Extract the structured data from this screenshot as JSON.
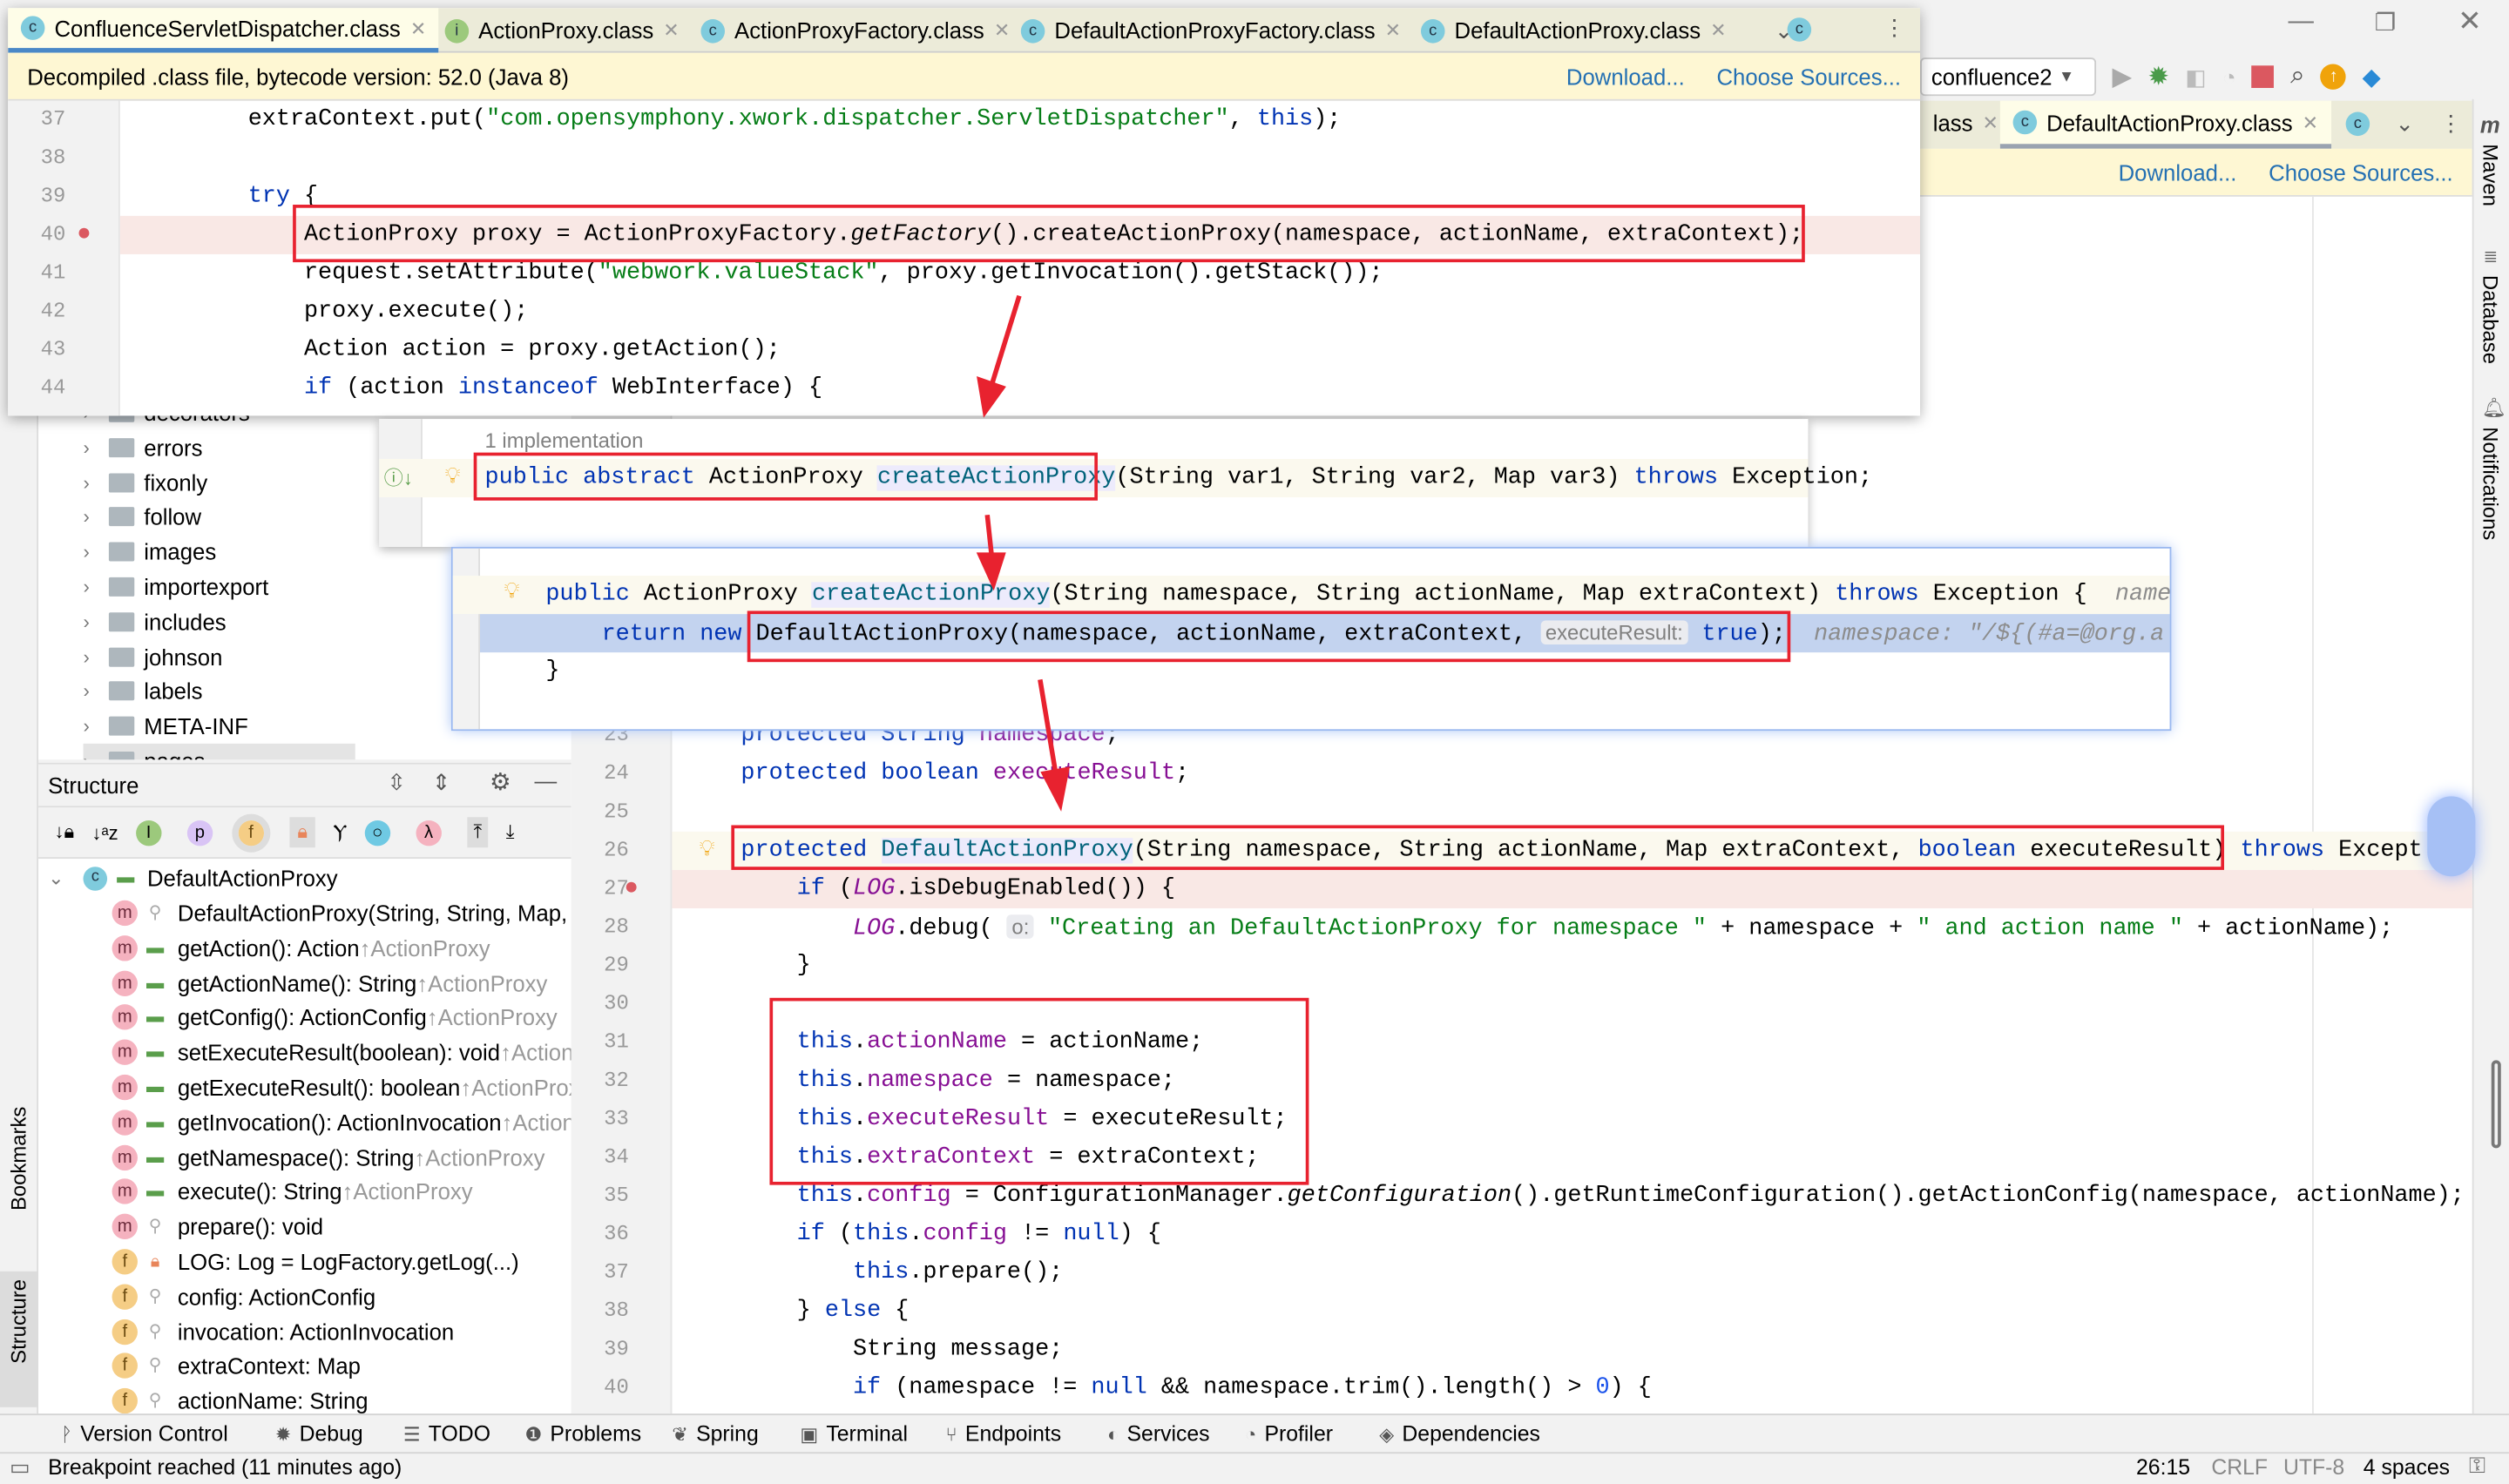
{
  "window": {
    "controls": [
      "minimize",
      "restore",
      "close"
    ]
  },
  "popup_editor": {
    "tabs": [
      {
        "label": "ConfluenceServletDispatcher.class",
        "icon": "C",
        "active": true
      },
      {
        "label": "ActionProxy.class",
        "icon": "I"
      },
      {
        "label": "ActionProxyFactory.class",
        "icon": "C"
      },
      {
        "label": "DefaultActionProxyFactory.class",
        "icon": "C"
      },
      {
        "label": "DefaultActionProxy.class",
        "icon": "C"
      }
    ],
    "banner": "Decompiled .class file, bytecode version: 52.0 (Java 8)",
    "download": "Download...",
    "choose_sources": "Choose Sources...",
    "lines": [
      {
        "n": "37",
        "ind": 2,
        "t": [
          [
            "extraContext.put(",
            "n"
          ],
          [
            "\"com.opensymphony.xwork.dispatcher.ServletDispatcher\"",
            "s"
          ],
          [
            ", ",
            "n"
          ],
          [
            "this",
            "k"
          ],
          [
            ");",
            "n"
          ]
        ]
      },
      {
        "n": "38",
        "ind": 0,
        "t": []
      },
      {
        "n": "39",
        "ind": 2,
        "t": [
          [
            "try",
            "k"
          ],
          [
            " {",
            "n"
          ]
        ]
      },
      {
        "n": "40",
        "ind": 3,
        "bp": true,
        "t": [
          [
            "ActionProxy proxy = ActionProxyFactory.",
            "n"
          ],
          [
            "getFactory",
            "i"
          ],
          [
            "().createActionProxy(namespace, actionName, extraContext);",
            "n"
          ]
        ]
      },
      {
        "n": "41",
        "ind": 3,
        "t": [
          [
            "request.setAttribute(",
            "n"
          ],
          [
            "\"webwork.valueStack\"",
            "s"
          ],
          [
            ", proxy.getInvocation().getStack());",
            "n"
          ]
        ]
      },
      {
        "n": "42",
        "ind": 3,
        "t": [
          [
            "proxy.execute();",
            "n"
          ]
        ]
      },
      {
        "n": "43",
        "ind": 3,
        "t": [
          [
            "Action action = proxy.getAction();",
            "n"
          ]
        ]
      },
      {
        "n": "44",
        "ind": 3,
        "t": [
          [
            "if",
            "k"
          ],
          [
            " (action ",
            "n"
          ],
          [
            "instanceof",
            "k"
          ],
          [
            " WebInterface) {",
            "n"
          ]
        ]
      }
    ]
  },
  "toolbar": {
    "run_config": "confluence2"
  },
  "main_tabs": [
    {
      "label": "lass"
    },
    {
      "label": "DefaultActionProxy.class",
      "active": true
    }
  ],
  "main_banner": {
    "download": "Download...",
    "choose_sources": "Choose Sources..."
  },
  "right_strip": [
    "Maven",
    "Database",
    "Notifications"
  ],
  "left_strip": [
    "Bookmarks",
    "Structure"
  ],
  "project_tree": [
    "decorators",
    "errors",
    "fixonly",
    "follow",
    "images",
    "importexport",
    "includes",
    "johnson",
    "labels",
    "META-INF",
    "pages"
  ],
  "structure": {
    "title": "Structure",
    "root": "DefaultActionProxy",
    "items": [
      {
        "b": "m",
        "name": "DefaultActionProxy(String, String, Map, boolean)",
        "inh": ""
      },
      {
        "b": "m",
        "name": "getAction(): Action",
        "inh": "↑ActionProxy"
      },
      {
        "b": "m",
        "name": "getActionName(): String",
        "inh": "↑ActionProxy"
      },
      {
        "b": "m",
        "name": "getConfig(): ActionConfig",
        "inh": "↑ActionProxy"
      },
      {
        "b": "m",
        "name": "setExecuteResult(boolean): void",
        "inh": "↑ActionProxy"
      },
      {
        "b": "m",
        "name": "getExecuteResult(): boolean",
        "inh": "↑ActionProxy"
      },
      {
        "b": "m",
        "name": "getInvocation(): ActionInvocation",
        "inh": "↑ActionProxy"
      },
      {
        "b": "m",
        "name": "getNamespace(): String",
        "inh": "↑ActionProxy"
      },
      {
        "b": "m",
        "name": "execute(): String",
        "inh": "↑ActionProxy"
      },
      {
        "b": "m",
        "name": "prepare(): void",
        "inh": ""
      },
      {
        "b": "f",
        "name": "LOG: Log = LogFactory.getLog(...)",
        "inh": ""
      },
      {
        "b": "f",
        "name": "config: ActionConfig",
        "inh": ""
      },
      {
        "b": "f",
        "name": "invocation: ActionInvocation",
        "inh": ""
      },
      {
        "b": "f",
        "name": "extraContext: Map",
        "inh": ""
      },
      {
        "b": "f",
        "name": "actionName: String",
        "inh": ""
      }
    ]
  },
  "impl_popup": {
    "header": "1 implementation",
    "t": [
      [
        "public abstract",
        "k"
      ],
      [
        " ActionProxy ",
        "n"
      ],
      [
        "createActionProxy",
        "s2"
      ],
      [
        "(String var1, String var2, Map var3) ",
        "n"
      ],
      [
        "throws",
        "k"
      ],
      [
        " Exception;",
        "n"
      ]
    ]
  },
  "factory_popup": {
    "line1": [
      [
        "public",
        "k"
      ],
      [
        " ActionProxy ",
        "n"
      ],
      [
        "createActionProxy",
        "s2"
      ],
      [
        "(String namespace, String actionName, Map extraContext) ",
        "n"
      ],
      [
        "throws",
        "k"
      ],
      [
        " Exception {  ",
        "n"
      ],
      [
        "name",
        "h"
      ]
    ],
    "line2": [
      [
        "return new",
        "k"
      ],
      [
        " DefaultActionProxy(namespace, actionName, extraContext, ",
        "n"
      ],
      [
        "executeResult:",
        "hint"
      ],
      [
        " ",
        "n"
      ],
      [
        "true",
        "k"
      ],
      [
        ");  ",
        "n"
      ],
      [
        "namespace: \"/${(#a=@org.a",
        "h"
      ]
    ],
    "line3": [
      [
        "}",
        "n"
      ]
    ]
  },
  "main_lines": [
    {
      "n": "23",
      "ind": 1,
      "t": [
        [
          "protected String ",
          "k0"
        ],
        [
          "namespace",
          "f"
        ],
        [
          ";",
          "n"
        ]
      ]
    },
    {
      "n": "24",
      "ind": 1,
      "t": [
        [
          "protected boolean ",
          "k"
        ],
        [
          "executeResult",
          "f"
        ],
        [
          ";",
          "n"
        ]
      ]
    },
    {
      "n": "25",
      "ind": 1,
      "t": []
    },
    {
      "n": "26",
      "ind": 1,
      "cur": true,
      "t": [
        [
          "protected ",
          "k"
        ],
        [
          "DefaultActionProxy",
          "s2"
        ],
        [
          "(String namespace, String actionName, Map extraContext, ",
          "n"
        ],
        [
          "boolean",
          "k"
        ],
        [
          " executeResult) ",
          "n"
        ],
        [
          "throws",
          "k"
        ],
        [
          " Except",
          "n"
        ]
      ]
    },
    {
      "n": "27",
      "ind": 2,
      "bp": true,
      "t": [
        [
          "if",
          "k"
        ],
        [
          " (",
          "n"
        ],
        [
          "LOG",
          "fi"
        ],
        [
          ".isDebugEnabled()) {",
          "n"
        ]
      ]
    },
    {
      "n": "28",
      "ind": 3,
      "t": [
        [
          "LOG",
          "fi"
        ],
        [
          ".debug( ",
          "n"
        ],
        [
          "o:",
          "hint"
        ],
        [
          " ",
          "n"
        ],
        [
          "\"Creating an DefaultActionProxy for namespace \"",
          "s"
        ],
        [
          " + namespace + ",
          "n"
        ],
        [
          "\" and action name \"",
          "s"
        ],
        [
          " + actionName);",
          "n"
        ]
      ]
    },
    {
      "n": "29",
      "ind": 2,
      "t": [
        [
          "}",
          "n"
        ]
      ]
    },
    {
      "n": "30",
      "ind": 2,
      "t": []
    },
    {
      "n": "31",
      "ind": 2,
      "t": [
        [
          "this",
          "k"
        ],
        [
          ".",
          "n"
        ],
        [
          "actionName",
          "f"
        ],
        [
          " = actionName;",
          "n"
        ]
      ]
    },
    {
      "n": "32",
      "ind": 2,
      "t": [
        [
          "this",
          "k"
        ],
        [
          ".",
          "n"
        ],
        [
          "namespace",
          "f"
        ],
        [
          " = namespace;",
          "n"
        ]
      ]
    },
    {
      "n": "33",
      "ind": 2,
      "t": [
        [
          "this",
          "k"
        ],
        [
          ".",
          "n"
        ],
        [
          "executeResult",
          "f"
        ],
        [
          " = executeResult;",
          "n"
        ]
      ]
    },
    {
      "n": "34",
      "ind": 2,
      "t": [
        [
          "this",
          "k"
        ],
        [
          ".",
          "n"
        ],
        [
          "extraContext",
          "f"
        ],
        [
          " = extraContext;",
          "n"
        ]
      ]
    },
    {
      "n": "35",
      "ind": 2,
      "t": [
        [
          "this",
          "k"
        ],
        [
          ".",
          "n"
        ],
        [
          "config",
          "f"
        ],
        [
          " = ConfigurationManager.",
          "n"
        ],
        [
          "getConfiguration",
          "i"
        ],
        [
          "().getRuntimeConfiguration().getActionConfig(namespace, actionName);",
          "n"
        ]
      ]
    },
    {
      "n": "36",
      "ind": 2,
      "t": [
        [
          "if",
          "k"
        ],
        [
          " (",
          "n"
        ],
        [
          "this",
          "k"
        ],
        [
          ".",
          "n"
        ],
        [
          "config",
          "f"
        ],
        [
          " != ",
          "n"
        ],
        [
          "null",
          "k"
        ],
        [
          ") {",
          "n"
        ]
      ]
    },
    {
      "n": "37",
      "ind": 3,
      "t": [
        [
          "this",
          "k"
        ],
        [
          ".prepare();",
          "n"
        ]
      ]
    },
    {
      "n": "38",
      "ind": 2,
      "t": [
        [
          "} ",
          "n"
        ],
        [
          "else",
          "k"
        ],
        [
          " {",
          "n"
        ]
      ]
    },
    {
      "n": "39",
      "ind": 3,
      "t": [
        [
          "String message;",
          "n"
        ]
      ]
    },
    {
      "n": "40",
      "ind": 3,
      "t": [
        [
          "if",
          "k"
        ],
        [
          " (namespace != ",
          "n"
        ],
        [
          "null",
          "k"
        ],
        [
          " && namespace.trim().length() > ",
          "n"
        ],
        [
          "0",
          "num"
        ],
        [
          ") {",
          "n"
        ]
      ]
    }
  ],
  "bottom_tools": [
    "Version Control",
    "Debug",
    "TODO",
    "Problems",
    "Spring",
    "Terminal",
    "Endpoints",
    "Services",
    "Profiler",
    "Dependencies"
  ],
  "status": {
    "message": "Breakpoint reached (11 minutes ago)",
    "position": "26:15",
    "line_sep": "CRLF",
    "encoding": "UTF-8",
    "indent": "4 spaces"
  },
  "colors": {
    "annotation_red": "#e8222f",
    "keyword": "#0033b3",
    "string": "#067d17",
    "field": "#871094",
    "breakpoint_line": "#f9e8e5"
  }
}
